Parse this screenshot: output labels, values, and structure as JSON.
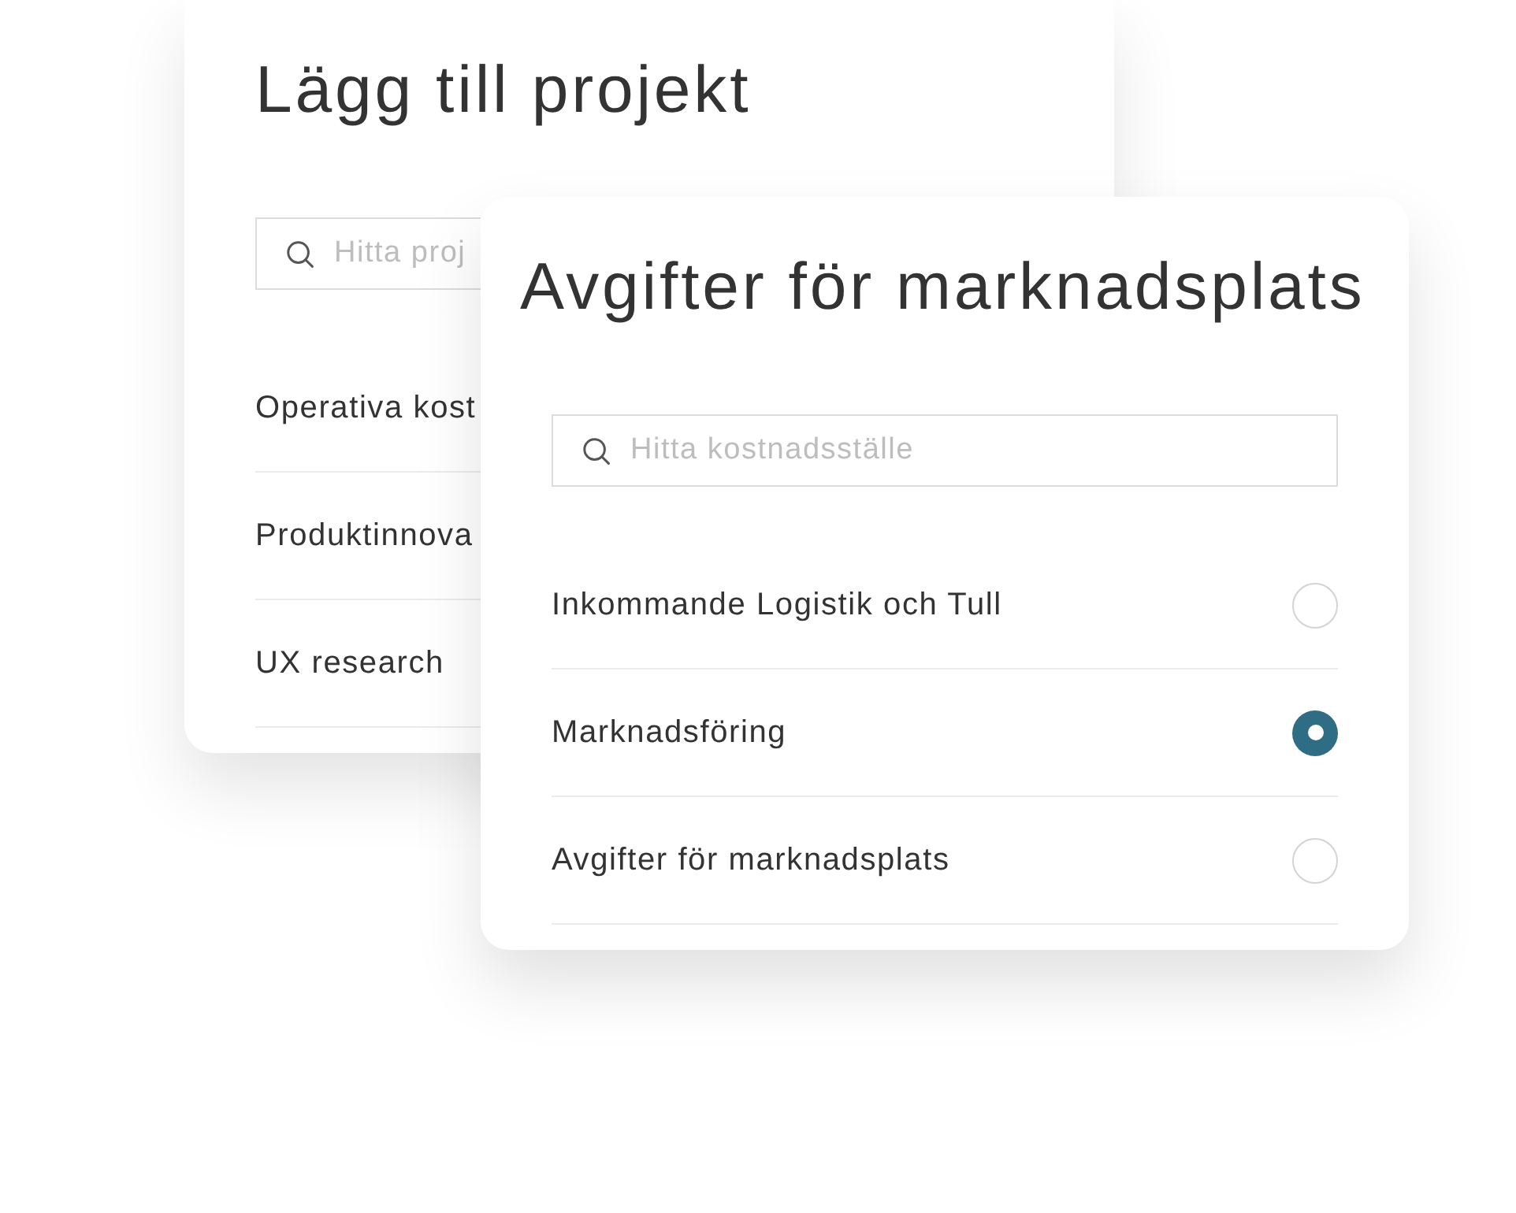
{
  "back_dialog": {
    "title": "Lägg till projekt",
    "search": {
      "placeholder": "Hitta proj"
    },
    "items": [
      {
        "label": "Operativa kost"
      },
      {
        "label": "Produktinnova"
      },
      {
        "label": "UX research"
      }
    ]
  },
  "front_dialog": {
    "title": "Avgifter för marknadsplats",
    "search": {
      "placeholder": "Hitta kostnadsställe"
    },
    "items": [
      {
        "label": "Inkommande Logistik och Tull",
        "selected": false
      },
      {
        "label": "Marknadsföring",
        "selected": true
      },
      {
        "label": "Avgifter för marknadsplats",
        "selected": false
      }
    ]
  }
}
